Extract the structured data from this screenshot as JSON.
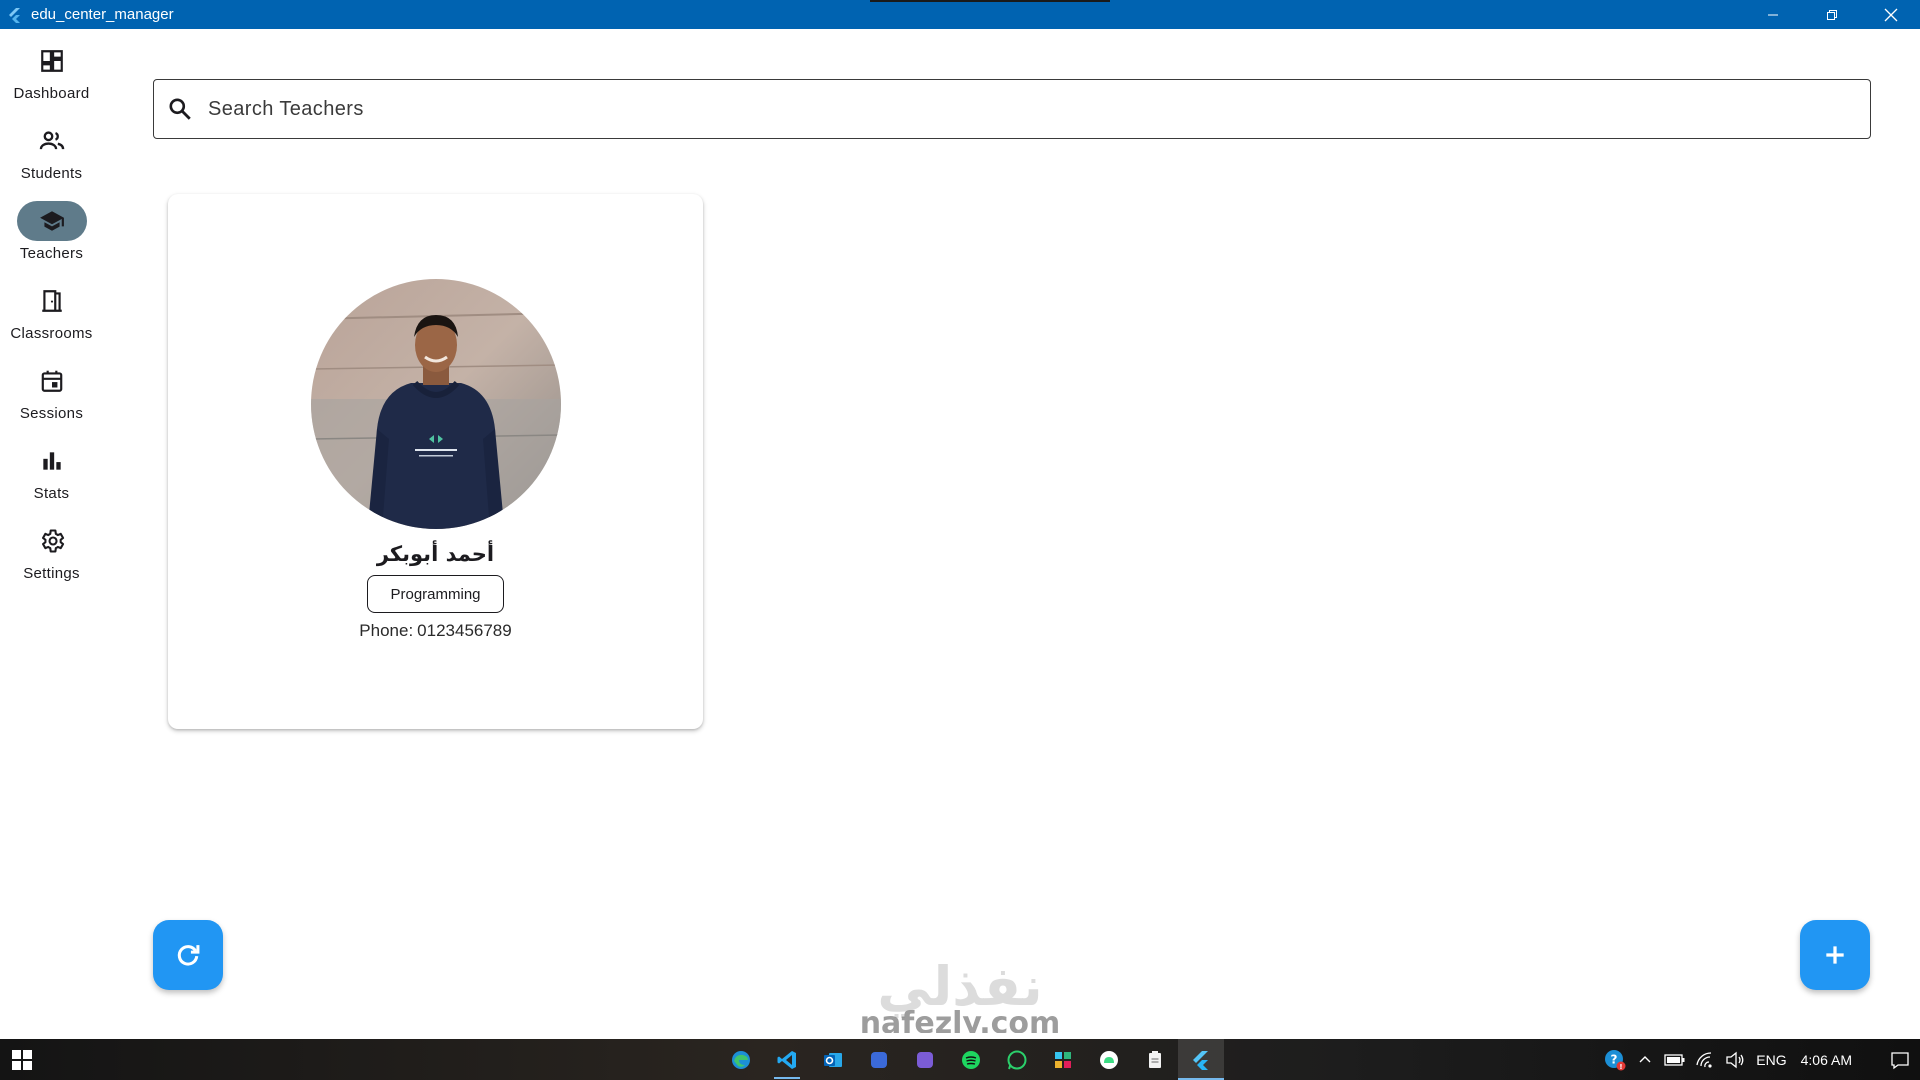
{
  "window": {
    "title": "edu_center_manager"
  },
  "nav": {
    "items": [
      {
        "label": "Dashboard",
        "icon": "dashboard-icon",
        "active": false
      },
      {
        "label": "Students",
        "icon": "people-icon",
        "active": false
      },
      {
        "label": "Teachers",
        "icon": "school-icon",
        "active": true
      },
      {
        "label": "Classrooms",
        "icon": "door-icon",
        "active": false
      },
      {
        "label": "Sessions",
        "icon": "calendar-icon",
        "active": false
      },
      {
        "label": "Stats",
        "icon": "bar-chart-icon",
        "active": false
      },
      {
        "label": "Settings",
        "icon": "gear-icon",
        "active": false
      }
    ]
  },
  "search": {
    "placeholder": "Search Teachers",
    "value": ""
  },
  "teachers": [
    {
      "name": "أحمد أبوبكر",
      "subject": "Programming",
      "phone_label": "Phone:",
      "phone": "0123456789"
    }
  ],
  "watermark": {
    "arabic": "نفذلي",
    "latin": "nafezly.com"
  },
  "taskbar": {
    "language": "ENG",
    "time": "4:06 AM",
    "apps": [
      "edge-icon",
      "vscode-icon",
      "outlook-icon",
      "spotify-icon",
      "whatsapp-icon",
      "slack-icon",
      "android-studio-icon",
      "notepad-icon",
      "flutter-icon"
    ]
  },
  "colors": {
    "titlebar": "#0063b1",
    "accent": "#2196f3",
    "nav_active": "#5f7b8a"
  }
}
